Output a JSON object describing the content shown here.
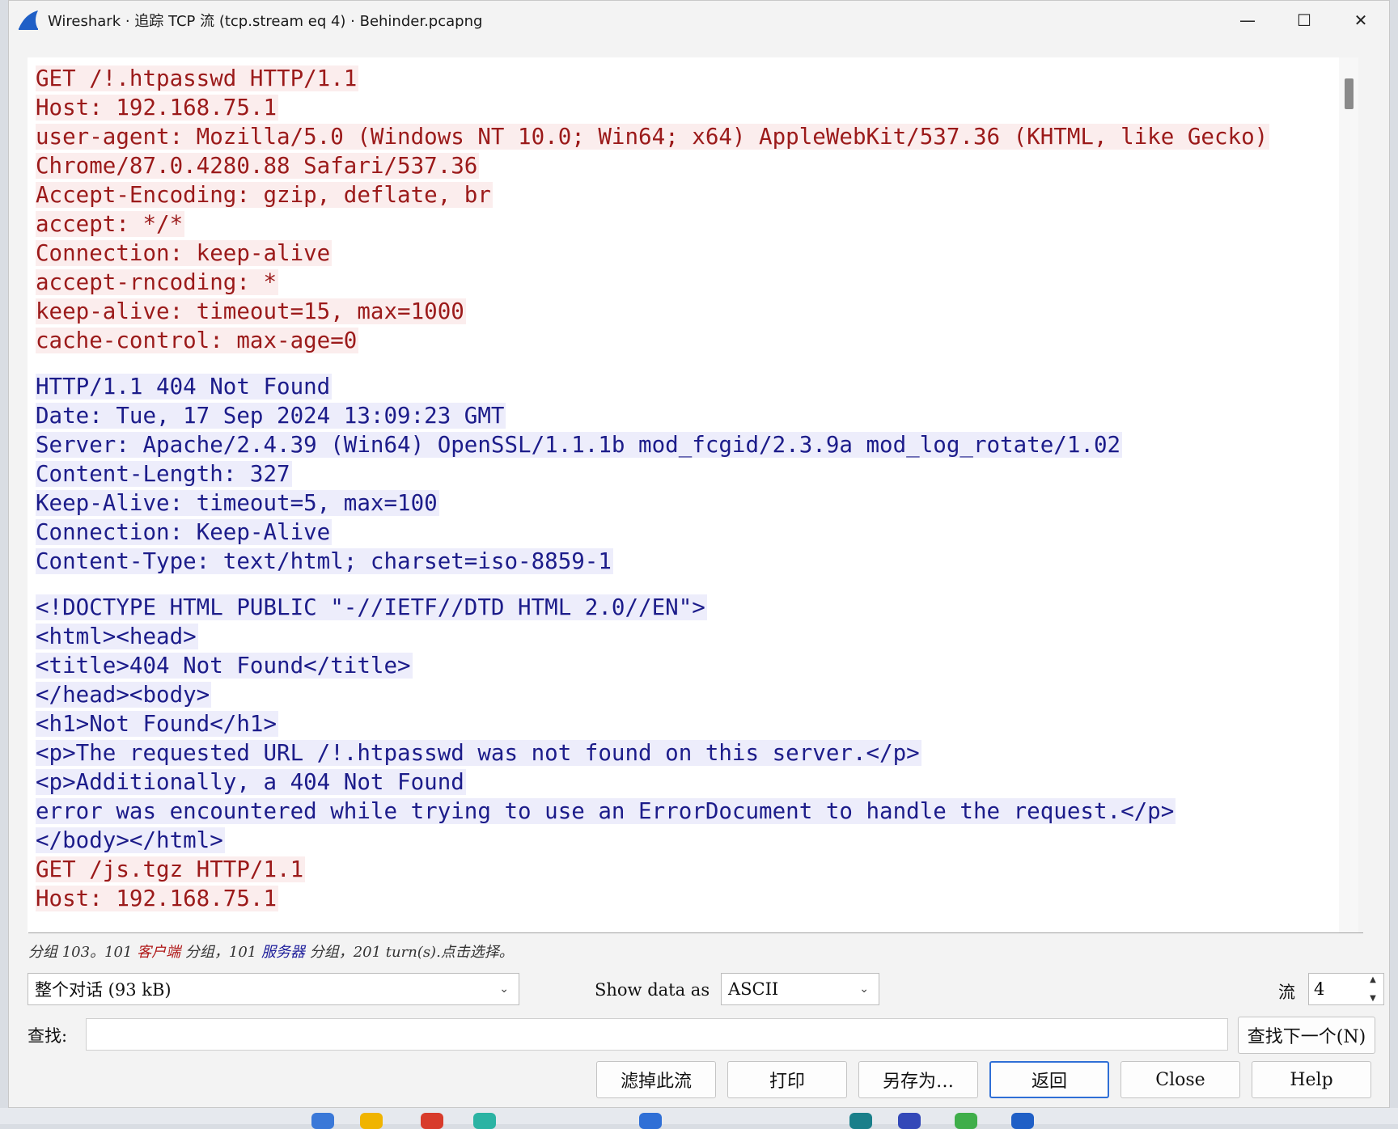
{
  "window": {
    "title": "Wireshark · 追踪 TCP 流 (tcp.stream eq 4) · Behinder.pcapng",
    "minimize": "—",
    "maximize": "☐",
    "close": "✕"
  },
  "stream": {
    "client_block_1": [
      "GET /!.htpasswd HTTP/1.1",
      "Host: 192.168.75.1",
      "user-agent: Mozilla/5.0 (Windows NT 10.0; Win64; x64) AppleWebKit/537.36 (KHTML, like Gecko)",
      "Chrome/87.0.4280.88 Safari/537.36",
      "Accept-Encoding: gzip, deflate, br",
      "accept: */*",
      "Connection: keep-alive",
      "accept-rncoding: *",
      "keep-alive: timeout=15, max=1000",
      "cache-control: max-age=0"
    ],
    "server_block_1": [
      "HTTP/1.1 404 Not Found",
      "Date: Tue, 17 Sep 2024 13:09:23 GMT",
      "Server: Apache/2.4.39 (Win64) OpenSSL/1.1.1b mod_fcgid/2.3.9a mod_log_rotate/1.02",
      "Content-Length: 327",
      "Keep-Alive: timeout=5, max=100",
      "Connection: Keep-Alive",
      "Content-Type: text/html; charset=iso-8859-1"
    ],
    "server_block_2": [
      "<!DOCTYPE HTML PUBLIC \"-//IETF//DTD HTML 2.0//EN\">",
      "<html><head>",
      "<title>404 Not Found</title>",
      "</head><body>",
      "<h1>Not Found</h1>",
      "<p>The requested URL /!.htpasswd was not found on this server.</p>",
      "<p>Additionally, a 404 Not Found",
      "error was encountered while trying to use an ErrorDocument to handle the request.</p>",
      "</body></html>"
    ],
    "client_block_2": [
      "GET /js.tgz HTTP/1.1",
      "Host: 192.168.75.1"
    ]
  },
  "status": {
    "prefix": "分组 103。101 ",
    "client_label": "客户端",
    "middle": " 分组，101 ",
    "server_label": "服务器",
    "suffix": " 分组，201 turn(s).点击选择。"
  },
  "controls": {
    "conversation_select": "整个对话 (93 kB)",
    "show_data_as_label": "Show data as",
    "show_data_as_value": "ASCII",
    "stream_label": "流",
    "stream_value": "4",
    "find_label": "查找:",
    "find_value": "",
    "find_next_label": "查找下一个(N)"
  },
  "buttons": {
    "filter_out": "滤掉此流",
    "print": "打印",
    "save_as": "另存为…",
    "back": "返回",
    "close": "Close",
    "help": "Help"
  },
  "colors": {
    "client_text": "#9b1a1a",
    "client_bg": "#fbeded",
    "server_text": "#1c1c8a",
    "server_bg": "#ededfb",
    "accent": "#2f6fd6"
  }
}
